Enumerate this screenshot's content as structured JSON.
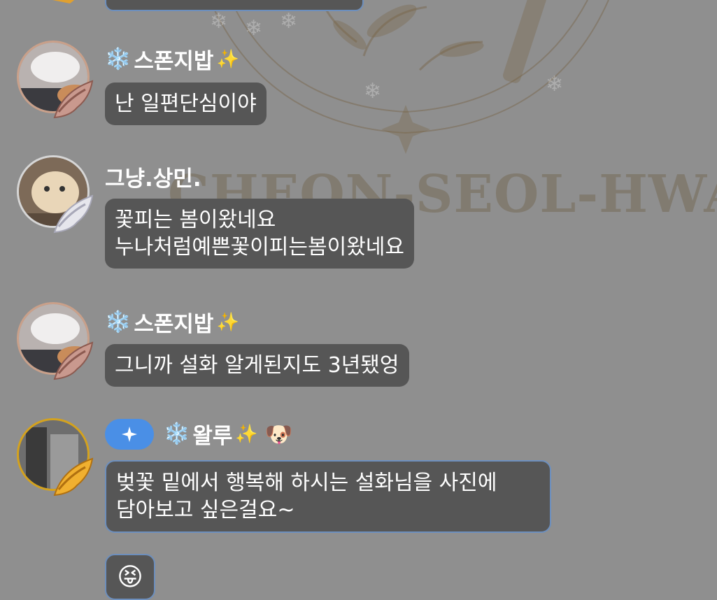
{
  "messages": [
    {
      "id": "m1",
      "sender": "스폰지밥",
      "snow": "❄️",
      "spark": "✨",
      "text_lines": [
        "난 일편단심이야"
      ]
    },
    {
      "id": "m2",
      "sender": "그냥.상민.",
      "text_lines": [
        "꽃피는 봄이왔네요",
        "누나처럼예쁜꽃이피는봄이왔네요"
      ]
    },
    {
      "id": "m3",
      "sender": "스폰지밥",
      "snow": "❄️",
      "spark": "✨",
      "text_lines": [
        "그니까 설화 알게된지도 3년됐엉"
      ]
    },
    {
      "id": "m4",
      "sender": "왈루",
      "snow": "❄️",
      "spark": "✨",
      "dog": "🐶",
      "badge_icon": "sparkle-icon",
      "text_lines": [
        "벚꽃 밑에서 행복해 하시는 설화님을 사진에",
        "담아보고 싶은걸요~"
      ],
      "emoji": "😝"
    }
  ],
  "background": {
    "watermark": "CHEON-SEOL-HWA"
  },
  "colors": {
    "background": "#8f8f8f",
    "bubble": "#565656",
    "bubble_border": "#6d8fbd",
    "badge": "#4a8fe6",
    "gold": "#d4a21d"
  }
}
